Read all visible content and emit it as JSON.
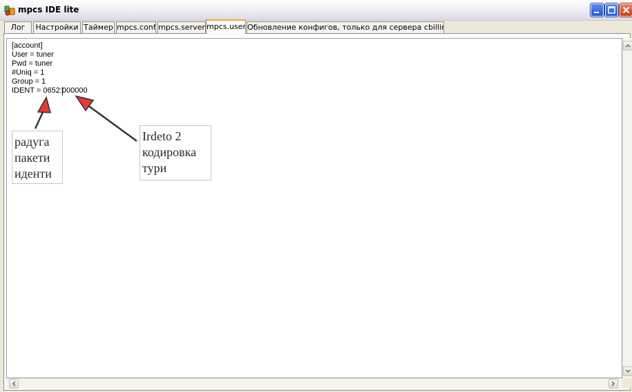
{
  "window": {
    "title": "mpcs IDE lite",
    "buttons": [
      "minimize",
      "maximize",
      "close"
    ]
  },
  "tabs": [
    {
      "label": "Лог",
      "active": false
    },
    {
      "label": "Настройки",
      "active": false
    },
    {
      "label": "Таймер",
      "active": false
    },
    {
      "label": "mpcs.conf",
      "active": false
    },
    {
      "label": "mpcs.server",
      "active": false
    },
    {
      "label": "mpcs.user",
      "active": true
    },
    {
      "label": "Обновление конфигов, только для сервера cbilling.net",
      "active": false
    }
  ],
  "editor": {
    "lines": [
      "[account]",
      "User = tuner",
      "Pwd = tuner",
      "#Uniq = 1",
      "Group = 1",
      "IDENT = 0652:000000"
    ]
  },
  "annotations": {
    "left_note": [
      "радуга",
      "пакети",
      "иденти"
    ],
    "right_note": [
      "Irdeto 2",
      "кодировка",
      "тури"
    ]
  },
  "colors": {
    "active_tab_accent": "#f5a623",
    "arrow_fill": "#e53935",
    "arrow_stroke": "#333333"
  },
  "icons": {
    "app": "mpcs-app-icon",
    "minimize": "minimize-icon",
    "maximize": "maximize-icon",
    "close": "close-icon"
  }
}
